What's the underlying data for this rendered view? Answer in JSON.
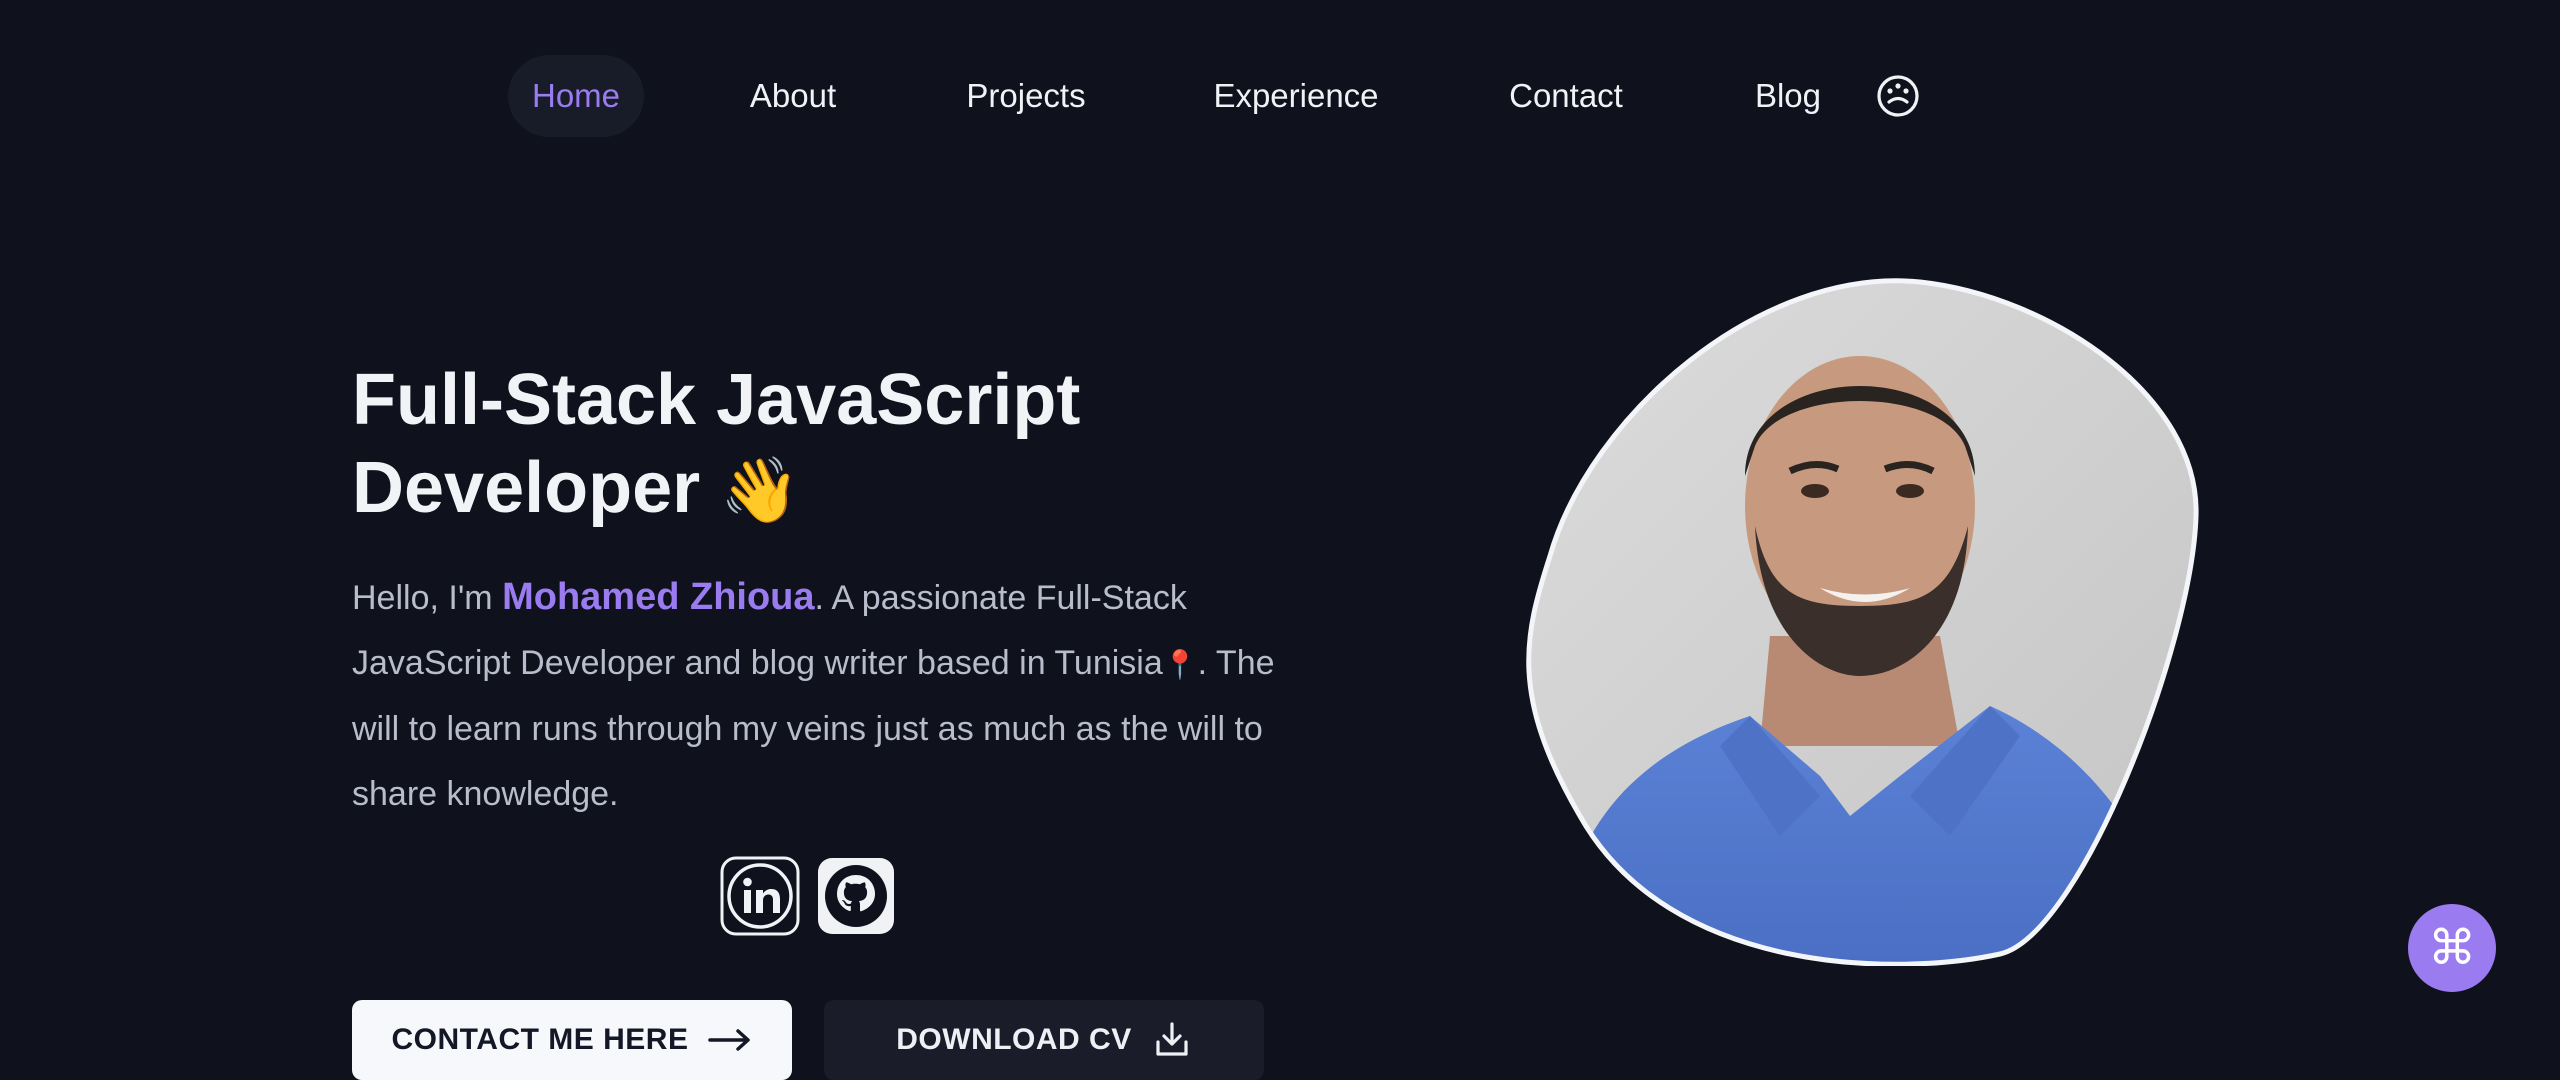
{
  "nav": {
    "items": [
      {
        "label": "Home",
        "active": true
      },
      {
        "label": "About"
      },
      {
        "label": "Projects"
      },
      {
        "label": "Experience"
      },
      {
        "label": "Contact"
      },
      {
        "label": "Blog"
      }
    ],
    "theme_toggle_icon": "palette-icon"
  },
  "hero": {
    "title_line1": "Full-Stack JavaScript",
    "title_line2": "Developer",
    "title_emoji": "👋",
    "intro_prefix": "Hello, I'm ",
    "name": "Mohamed Zhioua",
    "intro_rest": ". A passionate Full-Stack JavaScript Developer and blog writer based in Tunisia",
    "location_emoji": "📍",
    "intro_end": ". The will to learn runs through my veins just as much as the will to share knowledge."
  },
  "social": [
    {
      "icon": "linkedin-icon"
    },
    {
      "icon": "github-icon"
    }
  ],
  "buttons": {
    "contact_label": "CONTACT ME HERE",
    "contact_icon": "arrow-right-icon",
    "cv_label": "DOWNLOAD CV",
    "cv_icon": "download-icon"
  },
  "fab": {
    "symbol": "⌘",
    "icon": "command-icon"
  },
  "colors": {
    "background": "#0f121d",
    "accent": "#9b7cf0",
    "text": "#f1f2f6",
    "muted_text": "#b8bccb"
  }
}
